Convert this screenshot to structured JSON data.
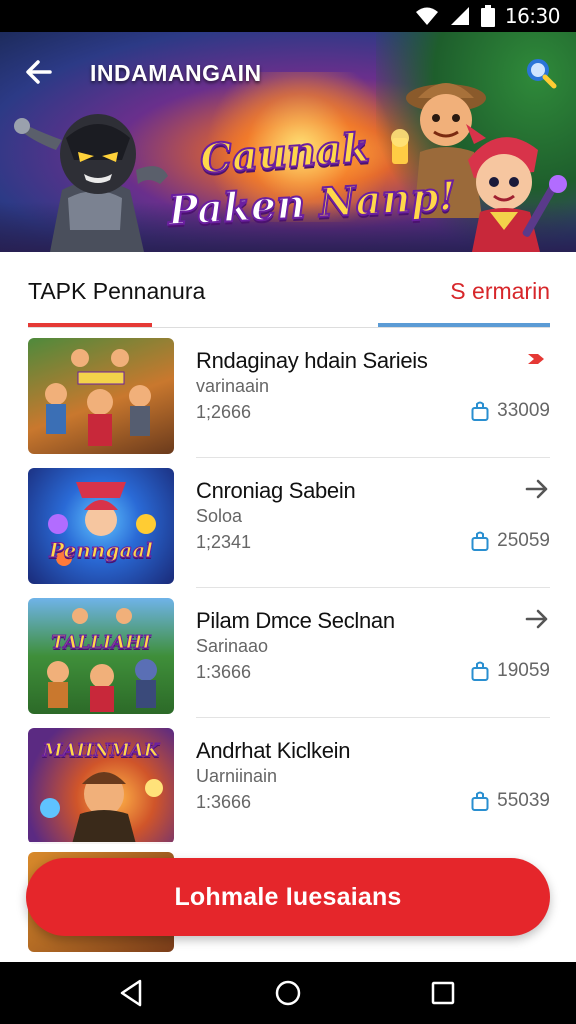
{
  "status_bar": {
    "time": "16:30",
    "icons": [
      "wifi-icon",
      "signal-icon",
      "battery-icon"
    ]
  },
  "hero": {
    "title": "INDAMANGAIN",
    "logo_line1": "Caunak",
    "logo_line2_a": "Paken",
    "logo_line2_b": " Nanp!",
    "icons": [
      "back-arrow-icon",
      "search-icon"
    ]
  },
  "tabs": [
    {
      "label": "TAPK Pennanura",
      "active": true
    },
    {
      "label": "S ermarin",
      "active": false
    }
  ],
  "list": [
    {
      "title": "Rndaginay hdain Sarieis",
      "subtitle": "varinaain",
      "meta": "1;2666",
      "count": "33009",
      "thumb_text": "",
      "thumb_colors": [
        "#3a7a3a",
        "#c9782e"
      ],
      "arrow_color": "#e53935"
    },
    {
      "title": "Cnroniag Sabein",
      "subtitle": "Soloa",
      "meta": "1;2341",
      "count": "25059",
      "thumb_text": "Penngaal",
      "thumb_colors": [
        "#1f3d9c",
        "#2a9ad6"
      ],
      "arrow_color": "#555555"
    },
    {
      "title": "Pilam Dmce Seclnan",
      "subtitle": "Sarinaao",
      "meta": "1:3666",
      "count": "19059",
      "thumb_text": "TALLIAHI",
      "thumb_colors": [
        "#2f7d34",
        "#9bd05a"
      ],
      "arrow_color": "#555555"
    },
    {
      "title": "Andrhat Kiclkein",
      "subtitle": "Uarniinain",
      "meta": "1:3666",
      "count": "55039",
      "thumb_text": "MAIINMAK",
      "thumb_colors": [
        "#5b2a82",
        "#e08a2a"
      ],
      "arrow_color": "#555555"
    }
  ],
  "cta": {
    "label": "Lohmale Iuesaians"
  },
  "colors": {
    "accent": "#e5262b",
    "tab_accent_right": "#5b9bd5",
    "count_icon": "#2a8fd0"
  }
}
